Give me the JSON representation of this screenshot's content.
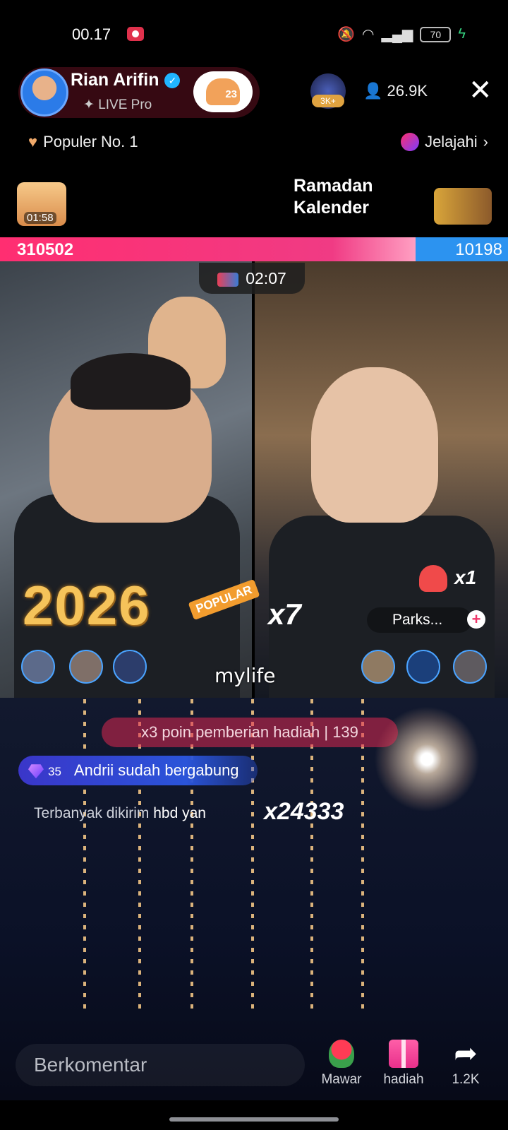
{
  "status_bar": {
    "time": "00.17",
    "battery": "70"
  },
  "host": {
    "name": "Rian Arifin",
    "subtitle": "✦ LIVE Pro",
    "follow_count": "23"
  },
  "top_gifter_badge": "3K+",
  "viewers": "26.9K",
  "ranking": {
    "popular_label": "Populer No. 1",
    "explore_label": "Jelajahi"
  },
  "treasure_timer": "01:58",
  "ramadan": {
    "line1": "Ramadan",
    "line2": "Kalender"
  },
  "battle": {
    "score_left": "310502",
    "score_right": "10198",
    "timer": "02:07",
    "left_progress_fraction": 0.818
  },
  "stickers": {
    "year": "2026",
    "popular_tag": "POPULAR",
    "combo_left": "x7",
    "combo_right": "x1",
    "opponent_name": "Parks...",
    "add_symbol": "+",
    "mylife": "mylife"
  },
  "feed": {
    "points_banner": "x3 poin pemberian hadiah  |  139",
    "join_level": "35",
    "join_text": "Andrii sudah bergabung",
    "most_sent_label": "Terbanyak dikirim",
    "most_sent_who": "hbd yan",
    "combo_big": "x24333"
  },
  "bottom_bar": {
    "comment_placeholder": "Berkomentar",
    "rose_label": "Mawar",
    "gift_label": "hadiah",
    "share_label": "1.2K"
  },
  "colors": {
    "red_team": "#ff2e71",
    "blue_team": "#2c93f0"
  }
}
